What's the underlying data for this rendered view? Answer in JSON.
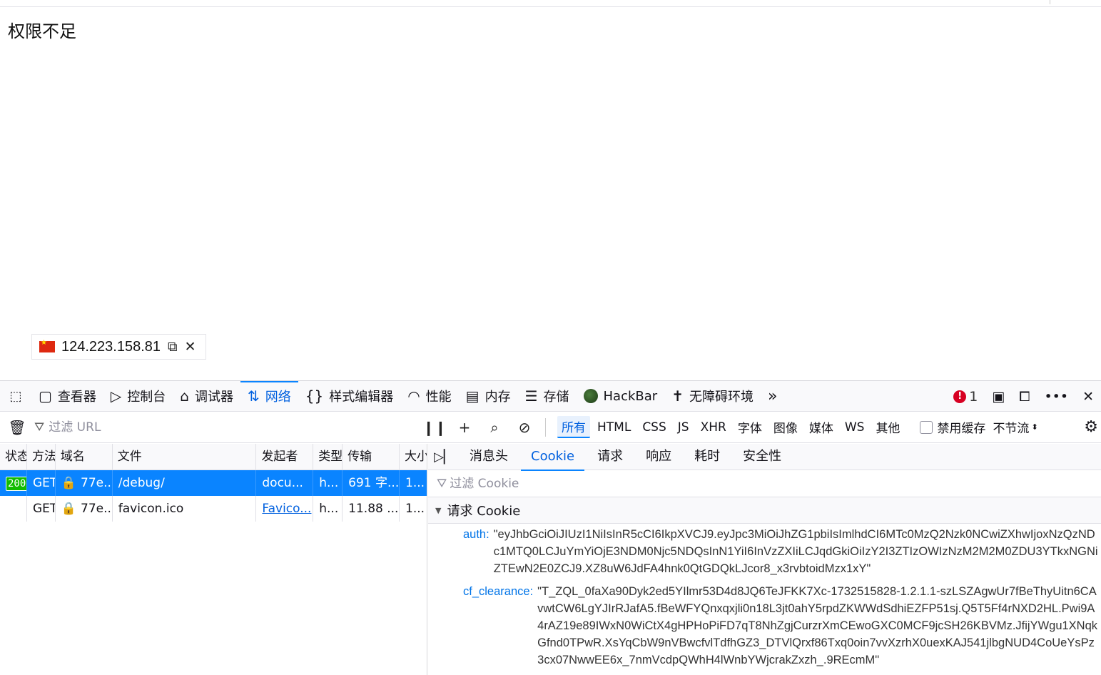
{
  "page": {
    "message": "权限不足"
  },
  "ip_badge": {
    "ip": "124.223.158.81",
    "flag": "CN"
  },
  "devtools": {
    "tabs": [
      {
        "id": "inspector",
        "icon": "inspector-icon",
        "glyph": "▢",
        "label": "查看器"
      },
      {
        "id": "console",
        "icon": "console-icon",
        "glyph": "▷",
        "label": "控制台"
      },
      {
        "id": "debugger",
        "icon": "debugger-icon",
        "glyph": "⌂",
        "label": "调试器"
      },
      {
        "id": "network",
        "icon": "network-icon",
        "glyph": "⇅",
        "label": "网络",
        "active": true
      },
      {
        "id": "style-editor",
        "icon": "style-editor-icon",
        "glyph": "{}",
        "label": "样式编辑器"
      },
      {
        "id": "performance",
        "icon": "performance-icon",
        "glyph": "◠",
        "label": "性能"
      },
      {
        "id": "memory",
        "icon": "memory-icon",
        "glyph": "▤",
        "label": "内存"
      },
      {
        "id": "storage",
        "icon": "storage-icon",
        "glyph": "☰",
        "label": "存储"
      },
      {
        "id": "hackbar",
        "icon": "hackbar-icon",
        "glyph": "",
        "label": "HackBar"
      },
      {
        "id": "accessibility",
        "icon": "accessibility-icon",
        "glyph": "✝",
        "label": "无障碍环境"
      }
    ],
    "error_count": "1",
    "toolbar": {
      "filter_placeholder": "过滤 URL",
      "type_filters": [
        "所有",
        "HTML",
        "CSS",
        "JS",
        "XHR",
        "字体",
        "图像",
        "媒体",
        "WS",
        "其他"
      ],
      "active_type_filter": "所有",
      "disable_cache_label": "禁用缓存",
      "throttle_label": "不节流"
    },
    "request_table": {
      "columns": [
        "状态",
        "方法",
        "域名",
        "文件",
        "发起者",
        "类型",
        "传输",
        "大小"
      ],
      "rows": [
        {
          "status": "200",
          "method": "GET",
          "domain": "77e...",
          "file": "/debug/",
          "initiator": "docu...",
          "type": "h...",
          "transferred": "691 字...",
          "size": "1...",
          "selected": true
        },
        {
          "status": "",
          "method": "GET",
          "domain": "77e...",
          "file": "favicon.ico",
          "initiator": "Favico...",
          "type": "h...",
          "transferred": "11.88 ...",
          "size": "1...",
          "selected": false
        }
      ]
    },
    "details": {
      "tabs": [
        "消息头",
        "Cookie",
        "请求",
        "响应",
        "耗时",
        "安全性"
      ],
      "active_tab": "Cookie",
      "cookie_filter_placeholder": "过滤 Cookie",
      "section_title": "请求 Cookie",
      "cookies": [
        {
          "name": "auth:",
          "value": "\"eyJhbGciOiJIUzI1NiIsInR5cCI6IkpXVCJ9.eyJpc3MiOiJhZG1pbiIsImlhdCI6MTc0MzQ2Nzk0NCwiZXhwIjoxNzQzNDc1MTQ0LCJuYmYiOjE3NDM0Njc5NDQsInN1YiI6InVzZXIiLCJqdGkiOiIzY2I3ZTIzOWIzNzM2M2M0ZDU3YTkxNGNiZTEwN2E0ZCJ9.XZ8uW6JdFA4hnk0QtGDQkLJcor8_x3rvbtoidMzx1xY\""
        },
        {
          "name": "cf_clearance:",
          "value": "\"T_ZQL_0faXa90Dyk2ed5YIlmr53D4d8JQ6TeJFKK7Xc-1732515828-1.2.1.1-szLSZAgwUr7fBeThyUitn6CAvwtCW6LgYJIrRJafA5.fBeWFYQnxqxjli0n18L3jt0ahY5rpdZKWWdSdhiEZFP51sj.Q5T5Ff4rNXD2HL.Pwi9A4rAZ19e89IWxN0WiCtX4gHPHoPiFD7qT8NhZgjCurzrXmCEwoGXC0MCF9jcSH26KBVMz.JfijYWgu1XNqkGfnd0TPwR.XsYqCbW9nVBwcfvlTdfhGZ3_DTVlQrxf86Txq0oin7vvXzrhX0uexKAJ541jlbgNUD4CoUeYsPz3cx07NwwEE6x_7nmVcdpQWhH4lWnbYWjcrakZxzh_.9REcmM\""
        }
      ]
    }
  }
}
